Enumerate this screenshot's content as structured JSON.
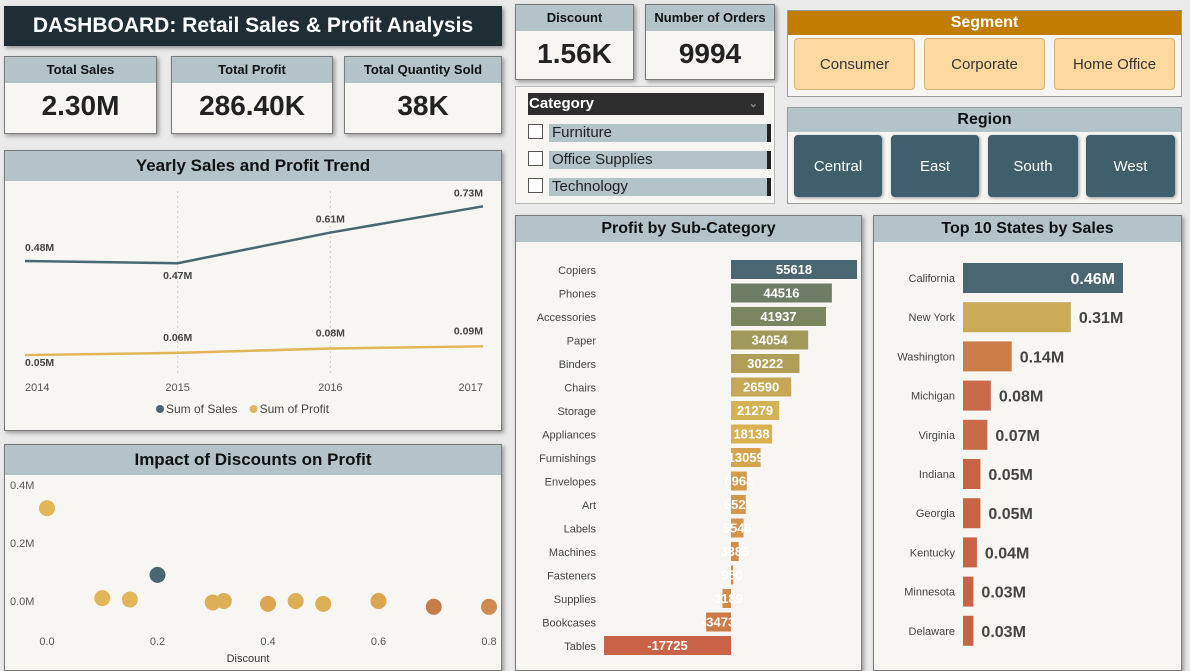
{
  "dashboard_title": "DASHBOARD: Retail Sales & Profit Analysis",
  "kpis": {
    "total_sales": {
      "label": "Total Sales",
      "value": "2.30M"
    },
    "total_profit": {
      "label": "Total Profit",
      "value": "286.40K"
    },
    "total_quantity": {
      "label": "Total Quantity Sold",
      "value": "38K"
    },
    "discount": {
      "label": "Discount",
      "value": "1.56K"
    },
    "orders": {
      "label": "Number of Orders",
      "value": "9994"
    }
  },
  "category_slicer": {
    "title": "Category",
    "items": [
      "Furniture",
      "Office Supplies",
      "Technology"
    ]
  },
  "segment_slicer": {
    "title": "Segment",
    "items": [
      "Consumer",
      "Corporate",
      "Home Office"
    ]
  },
  "region_slicer": {
    "title": "Region",
    "items": [
      "Central",
      "East",
      "South",
      "West"
    ]
  },
  "colors": {
    "sales": "#4a6670",
    "profit": "#e2b558",
    "header": "#b3c3c8",
    "title_bg": "#1f2d34",
    "segment_btn": "#fdd9a0",
    "region_btn": "#3e5f6b"
  },
  "chart_data": [
    {
      "id": "trend",
      "type": "line",
      "title": "Yearly Sales and Profit Trend",
      "x": [
        "2014",
        "2015",
        "2016",
        "2017"
      ],
      "series": [
        {
          "name": "Sum of Sales",
          "values": [
            0.48,
            0.47,
            0.61,
            0.73
          ],
          "labels": [
            "0.48M",
            "0.47M",
            "0.61M",
            "0.73M"
          ],
          "color": "#4a6670"
        },
        {
          "name": "Sum of Profit",
          "values": [
            0.05,
            0.06,
            0.08,
            0.09
          ],
          "labels": [
            "0.05M",
            "0.06M",
            "0.08M",
            "0.09M"
          ],
          "color": "#e2b558"
        }
      ],
      "ylim": [
        0,
        0.8
      ],
      "legend": "bottom"
    },
    {
      "id": "discount",
      "type": "scatter",
      "title": "Impact of Discounts on Profit",
      "xlabel": "Discount",
      "xticks": [
        "0.0",
        "0.2",
        "0.4",
        "0.6",
        "0.8"
      ],
      "yticks": [
        "0.0M",
        "0.2M",
        "0.4M"
      ],
      "xlim": [
        0,
        0.8
      ],
      "ylim": [
        0,
        0.4
      ],
      "points": [
        {
          "x": 0.0,
          "y": 0.32,
          "color": "#e2b558"
        },
        {
          "x": 0.1,
          "y": 0.01,
          "color": "#e2b558"
        },
        {
          "x": 0.15,
          "y": 0.005,
          "color": "#e2b558"
        },
        {
          "x": 0.2,
          "y": 0.09,
          "color": "#4a6670"
        },
        {
          "x": 0.3,
          "y": -0.005,
          "color": "#ddb058"
        },
        {
          "x": 0.32,
          "y": 0.0,
          "color": "#ddb058"
        },
        {
          "x": 0.4,
          "y": -0.01,
          "color": "#dca552"
        },
        {
          "x": 0.45,
          "y": 0.0,
          "color": "#ddb058"
        },
        {
          "x": 0.5,
          "y": -0.01,
          "color": "#ddb058"
        },
        {
          "x": 0.6,
          "y": 0.0,
          "color": "#dca552"
        },
        {
          "x": 0.7,
          "y": -0.02,
          "color": "#c67c48"
        },
        {
          "x": 0.8,
          "y": -0.02,
          "color": "#d08a50"
        }
      ]
    },
    {
      "id": "subcat",
      "type": "bar",
      "title": "Profit by Sub-Category",
      "categories": [
        "Copiers",
        "Phones",
        "Accessories",
        "Paper",
        "Binders",
        "Chairs",
        "Storage",
        "Appliances",
        "Furnishings",
        "Envelopes",
        "Art",
        "Labels",
        "Machines",
        "Fasteners",
        "Supplies",
        "Bookcases",
        "Tables"
      ],
      "values": [
        55618,
        44516,
        41937,
        34054,
        30222,
        26590,
        21279,
        18138,
        13059,
        6964,
        6528,
        5546,
        3385,
        950,
        -1189,
        -3473,
        -17725
      ],
      "colors": [
        "#4a6670",
        "#6f7d66",
        "#7a8660",
        "#a09a5a",
        "#b09e56",
        "#c4a855",
        "#d4b354",
        "#d9b150",
        "#d6a34e",
        "#d49a4c",
        "#d3964b",
        "#d3934b",
        "#d08c4a",
        "#d08b4a",
        "#d08b4a",
        "#cc7a46",
        "#c96246"
      ]
    },
    {
      "id": "states",
      "type": "bar",
      "title": "Top 10 States by Sales",
      "categories": [
        "California",
        "New York",
        "Washington",
        "Michigan",
        "Virginia",
        "Indiana",
        "Georgia",
        "Kentucky",
        "Minnesota",
        "Delaware"
      ],
      "values": [
        0.46,
        0.31,
        0.14,
        0.08,
        0.07,
        0.05,
        0.05,
        0.04,
        0.03,
        0.03
      ],
      "labels": [
        "0.46M",
        "0.31M",
        "0.14M",
        "0.08M",
        "0.07M",
        "0.05M",
        "0.05M",
        "0.04M",
        "0.03M",
        "0.03M"
      ],
      "colors": [
        "#4a6670",
        "#c9ab55",
        "#cc7e48",
        "#c96a48",
        "#c96a48",
        "#c66445",
        "#c66445",
        "#c66445",
        "#c66445",
        "#c66445"
      ]
    }
  ]
}
